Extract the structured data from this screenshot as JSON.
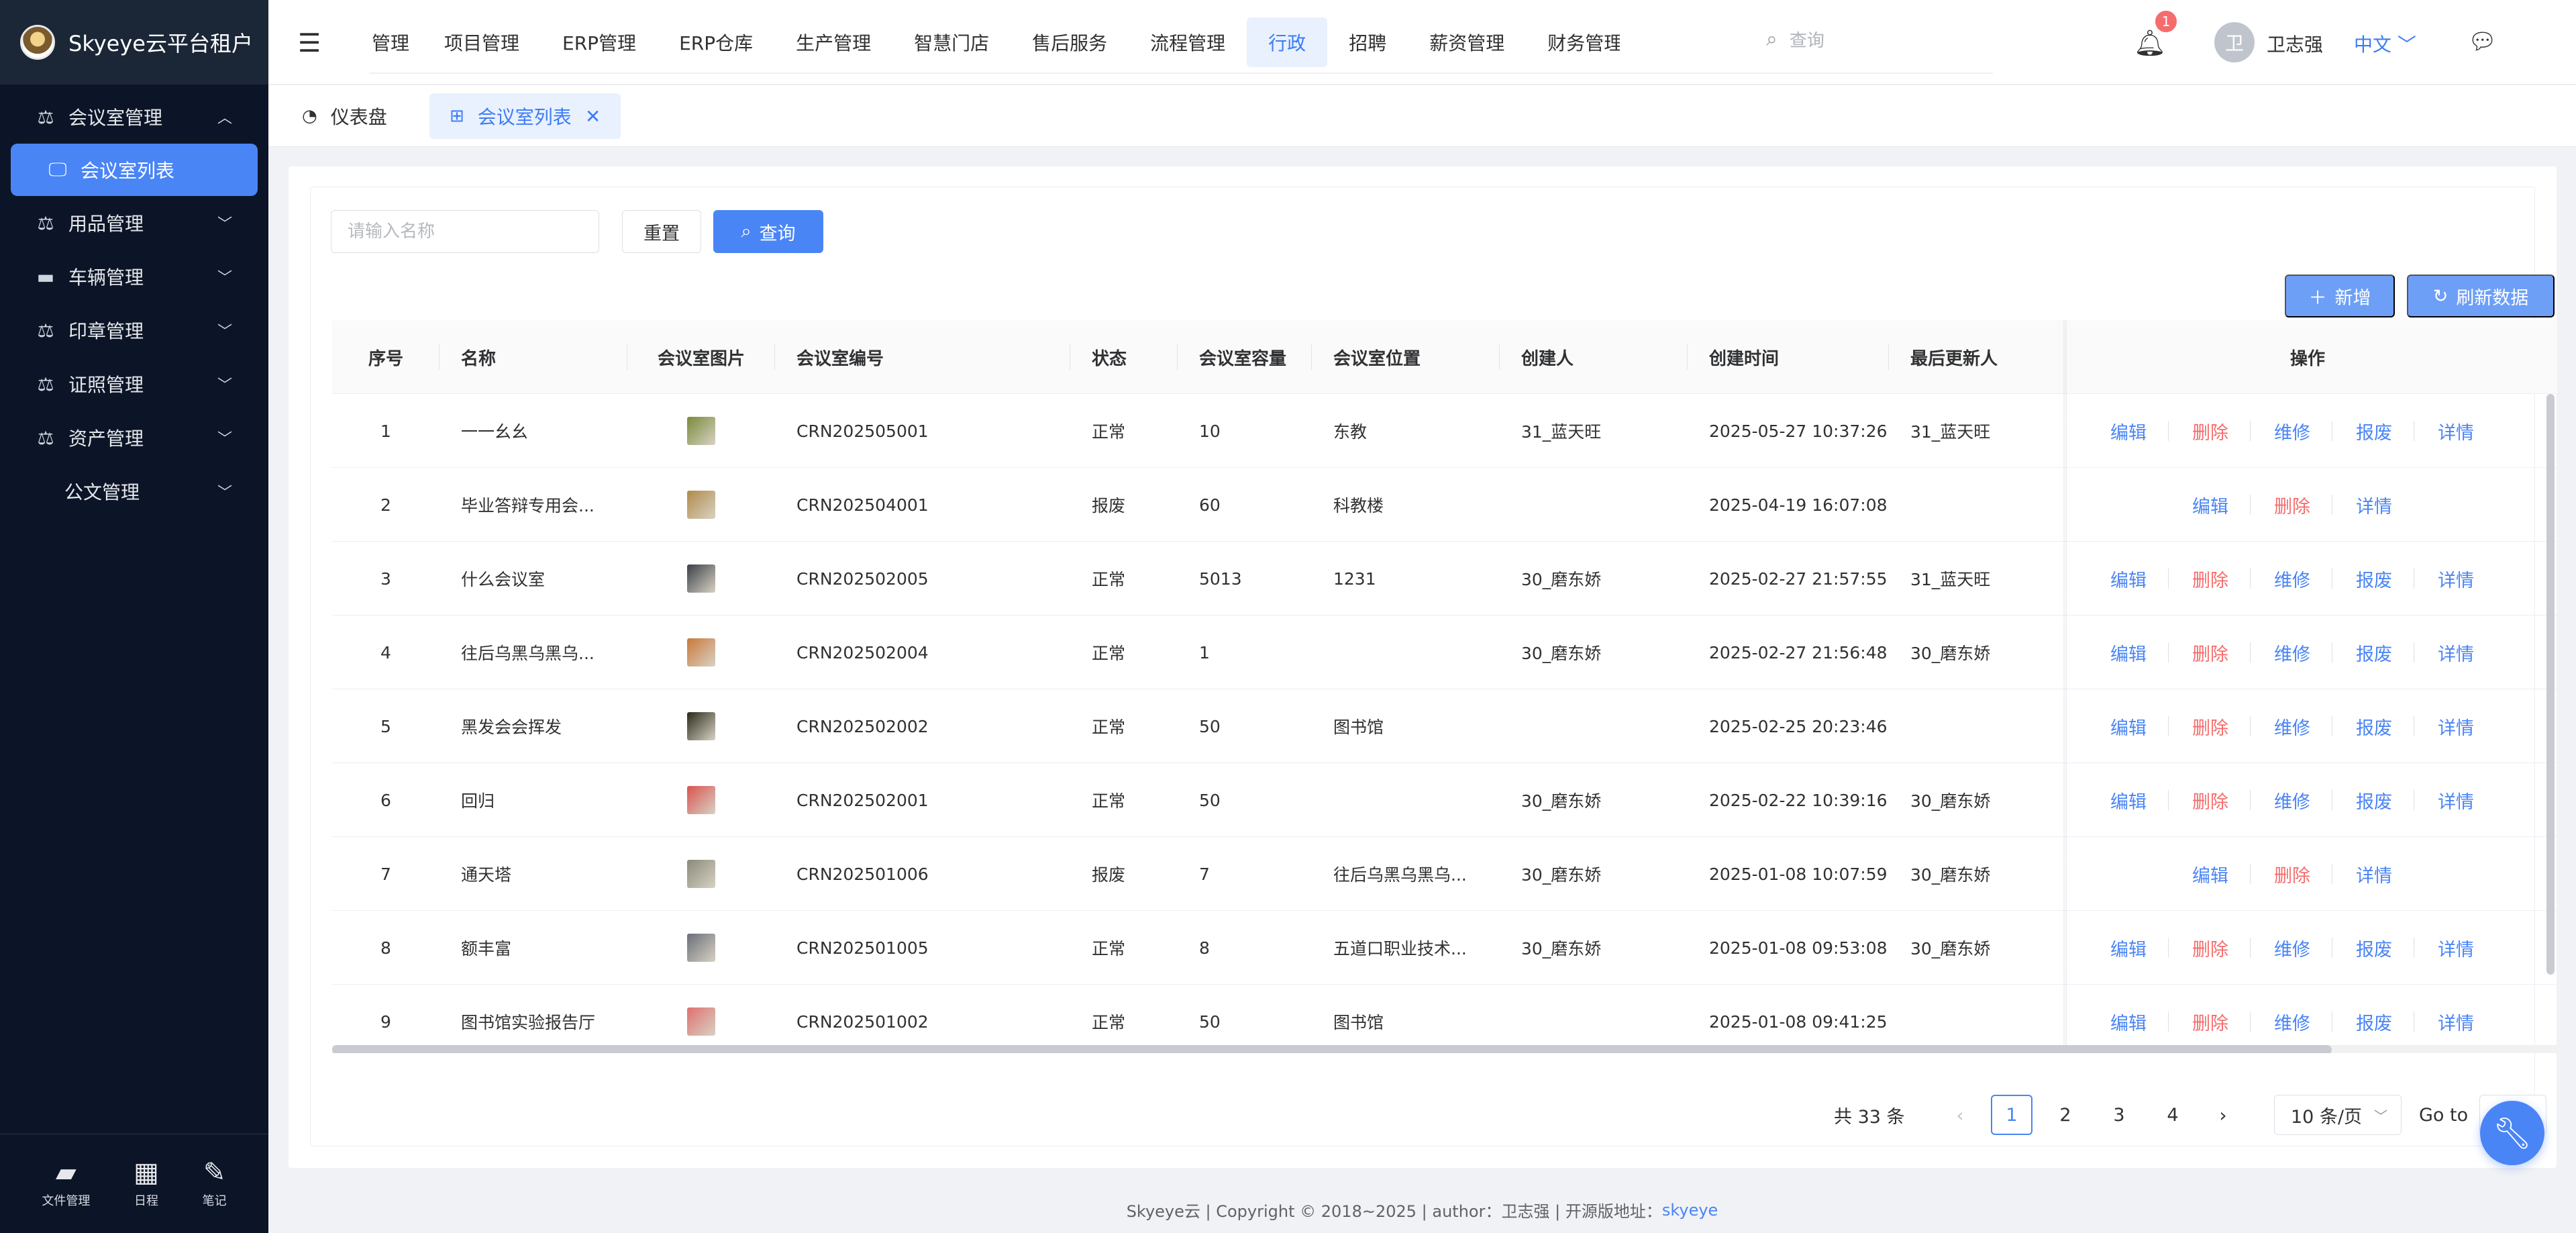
{
  "brand": {
    "title": "Skyeye云平台租户"
  },
  "sidebar": {
    "items": [
      {
        "label": "会议室管理",
        "icon": "scale-icon",
        "expanded": true
      },
      {
        "label": "会议室列表",
        "icon": "monitor-icon",
        "active": true
      },
      {
        "label": "用品管理",
        "icon": "scale-icon"
      },
      {
        "label": "车辆管理",
        "icon": "car-icon"
      },
      {
        "label": "印章管理",
        "icon": "scale-icon"
      },
      {
        "label": "证照管理",
        "icon": "scale-icon"
      },
      {
        "label": "资产管理",
        "icon": "scale-icon"
      },
      {
        "label": "公文管理",
        "icon": ""
      }
    ],
    "bottom": [
      {
        "label": "文件管理",
        "icon": "folder-icon"
      },
      {
        "label": "日程",
        "icon": "calendar-icon"
      },
      {
        "label": "笔记",
        "icon": "edit-icon"
      }
    ]
  },
  "header": {
    "nav": [
      "管理",
      "项目管理",
      "ERP管理",
      "ERP仓库",
      "生产管理",
      "智慧门店",
      "售后服务",
      "流程管理",
      "行政",
      "招聘",
      "薪资管理",
      "财务管理"
    ],
    "active_nav": "行政",
    "search_placeholder": "查询",
    "notification_count": "1",
    "avatar_letter": "卫",
    "user_name": "卫志强",
    "language": "中文"
  },
  "tabs": [
    {
      "label": "仪表盘",
      "icon": "dashboard-icon"
    },
    {
      "label": "会议室列表",
      "icon": "grid-icon",
      "active": true,
      "close": "✕"
    }
  ],
  "toolbar": {
    "search_placeholder": "请输入名称",
    "reset_label": "重置",
    "query_label": "查询",
    "add_label": "新增",
    "refresh_label": "刷新数据"
  },
  "table": {
    "columns": [
      "序号",
      "名称",
      "会议室图片",
      "会议室编号",
      "状态",
      "会议室容量",
      "会议室位置",
      "创建人",
      "创建时间",
      "最后更新人",
      "操作"
    ],
    "rows": [
      {
        "no": "1",
        "name": "一一幺幺",
        "code": "CRN202505001",
        "status": "正常",
        "capacity": "10",
        "location": "东教",
        "creator": "31_蓝天旺",
        "created": "2025-05-27 10:37:26",
        "updater": "31_蓝天旺",
        "thumb": "#7a8a3a",
        "actions": [
          "编辑",
          "删除",
          "维修",
          "报废",
          "详情"
        ]
      },
      {
        "no": "2",
        "name": "毕业答辩专用会...",
        "code": "CRN202504001",
        "status": "报废",
        "capacity": "60",
        "location": "科教楼",
        "creator": "",
        "created": "2025-04-19 16:07:08",
        "updater": "",
        "thumb": "#b08a4a",
        "actions": [
          "编辑",
          "删除",
          "详情"
        ]
      },
      {
        "no": "3",
        "name": "什么会议室",
        "code": "CRN202502005",
        "status": "正常",
        "capacity": "5013",
        "location": "1231",
        "creator": "30_磨东娇",
        "created": "2025-02-27 21:57:55",
        "updater": "31_蓝天旺",
        "thumb": "#3a3f48",
        "actions": [
          "编辑",
          "删除",
          "维修",
          "报废",
          "详情"
        ]
      },
      {
        "no": "4",
        "name": "往后乌黑乌黑乌...",
        "code": "CRN202502004",
        "status": "正常",
        "capacity": "1",
        "location": "",
        "creator": "30_磨东娇",
        "created": "2025-02-27 21:56:48",
        "updater": "30_磨东娇",
        "thumb": "#c9783a",
        "actions": [
          "编辑",
          "删除",
          "维修",
          "报废",
          "详情"
        ]
      },
      {
        "no": "5",
        "name": "黑发会会挥发",
        "code": "CRN202502002",
        "status": "正常",
        "capacity": "50",
        "location": "图书馆",
        "creator": "",
        "created": "2025-02-25 20:23:46",
        "updater": "",
        "thumb": "#2a2a1a",
        "actions": [
          "编辑",
          "删除",
          "维修",
          "报废",
          "详情"
        ]
      },
      {
        "no": "6",
        "name": "回归",
        "code": "CRN202502001",
        "status": "正常",
        "capacity": "50",
        "location": "",
        "creator": "30_磨东娇",
        "created": "2025-02-22 10:39:16",
        "updater": "30_磨东娇",
        "thumb": "#d9534f",
        "actions": [
          "编辑",
          "删除",
          "维修",
          "报废",
          "详情"
        ]
      },
      {
        "no": "7",
        "name": "通天塔",
        "code": "CRN202501006",
        "status": "报废",
        "capacity": "7",
        "location": "往后乌黑乌黑乌...",
        "creator": "30_磨东娇",
        "created": "2025-01-08 10:07:59",
        "updater": "30_磨东娇",
        "thumb": "#8a8a7a",
        "actions": [
          "编辑",
          "删除",
          "详情"
        ]
      },
      {
        "no": "8",
        "name": "额丰富",
        "code": "CRN202501005",
        "status": "正常",
        "capacity": "8",
        "location": "五道口职业技术...",
        "creator": "30_磨东娇",
        "created": "2025-01-08 09:53:08",
        "updater": "30_磨东娇",
        "thumb": "#6a6e78",
        "actions": [
          "编辑",
          "删除",
          "维修",
          "报废",
          "详情"
        ]
      },
      {
        "no": "9",
        "name": "图书馆实验报告厅",
        "code": "CRN202501002",
        "status": "正常",
        "capacity": "50",
        "location": "图书馆",
        "creator": "",
        "created": "2025-01-08 09:41:25",
        "updater": "",
        "thumb": "#e07070",
        "actions": [
          "编辑",
          "删除",
          "维修",
          "报废",
          "详情"
        ]
      }
    ]
  },
  "pagination": {
    "total": "共 33 条",
    "pages": [
      "1",
      "2",
      "3",
      "4"
    ],
    "current": "1",
    "page_size": "10 条/页",
    "goto_label": "Go to"
  },
  "footer": {
    "text": "Skyeye云 | Copyright © 2018~2025 | author：卫志强 | 开源版地址：",
    "link": "skyeye"
  },
  "colors": {
    "primary": "#4a85f6",
    "danger": "#f56c6c",
    "sidebar_bg": "#0c1527"
  }
}
